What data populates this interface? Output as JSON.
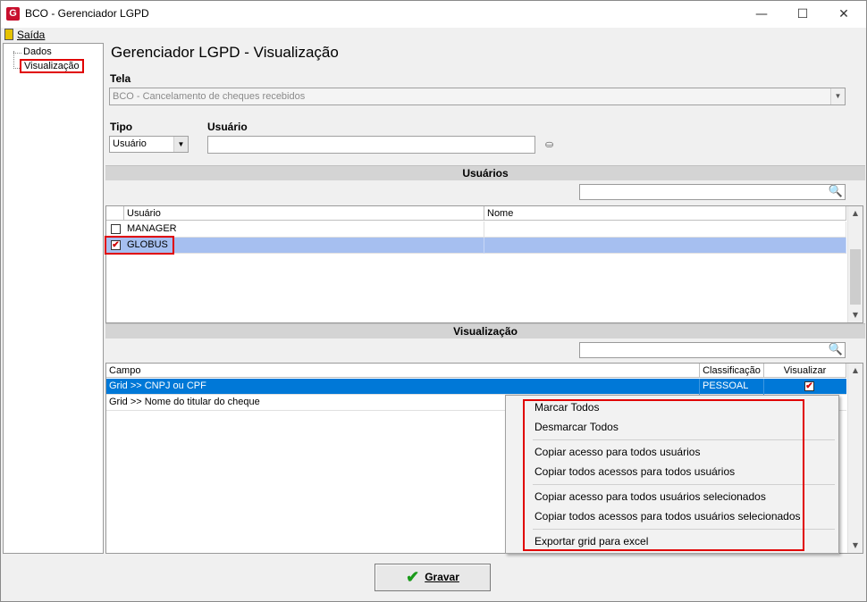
{
  "window": {
    "title": "BCO - Gerenciador LGPD",
    "app_icon": "G",
    "controls": {
      "minimize": "—",
      "maximize": "☐",
      "close": "✕"
    }
  },
  "menu": {
    "exit_label": "Saída"
  },
  "tree": {
    "items": [
      "Dados",
      "Visualização"
    ],
    "selected": "Visualização"
  },
  "page_title": "Gerenciador LGPD - Visualização",
  "tela": {
    "label": "Tela",
    "value": "BCO - Cancelamento de cheques recebidos"
  },
  "tipo": {
    "label": "Tipo",
    "value": "Usuário"
  },
  "usuario": {
    "label": "Usuário",
    "value": ""
  },
  "users_section": {
    "title": "Usuários",
    "search_value": "",
    "columns": [
      "Usuário",
      "Nome"
    ],
    "rows": [
      {
        "checked": false,
        "check_mark": "",
        "usuario": "MANAGER",
        "nome": ""
      },
      {
        "checked": true,
        "check_mark": "✔",
        "usuario": "GLOBUS",
        "nome": ""
      }
    ]
  },
  "view_section": {
    "title": "Visualização",
    "search_value": "",
    "columns": [
      "Campo",
      "Classificação",
      "Visualizar"
    ],
    "rows": [
      {
        "campo": "Grid >> CNPJ ou CPF",
        "classificacao": "PESSOAL",
        "visualizar": true,
        "check_mark": "✔"
      },
      {
        "campo": "Grid >> Nome do titular do cheque",
        "classificacao": "",
        "visualizar": false,
        "check_mark": ""
      }
    ]
  },
  "context_menu": {
    "items": [
      "Marcar Todos",
      "Desmarcar Todos",
      "Copiar acesso para todos usuários",
      "Copiar todos acessos para todos usuários",
      "Copiar acesso para todos usuários selecionados",
      "Copiar todos acessos para todos usuários selecionados",
      "Exportar grid para excel"
    ]
  },
  "buttons": {
    "save_label": "Gravar"
  },
  "icons": {
    "search": "🔍",
    "binoculars": "⛀",
    "check": "✔",
    "dropdown": "▼",
    "scroll_up": "▲",
    "scroll_down": "▼"
  },
  "colors": {
    "selection_blue": "#0078d7",
    "row_highlight": "#a6bff0",
    "red_highlight": "#e00000",
    "check_green": "#1a9a1a"
  }
}
